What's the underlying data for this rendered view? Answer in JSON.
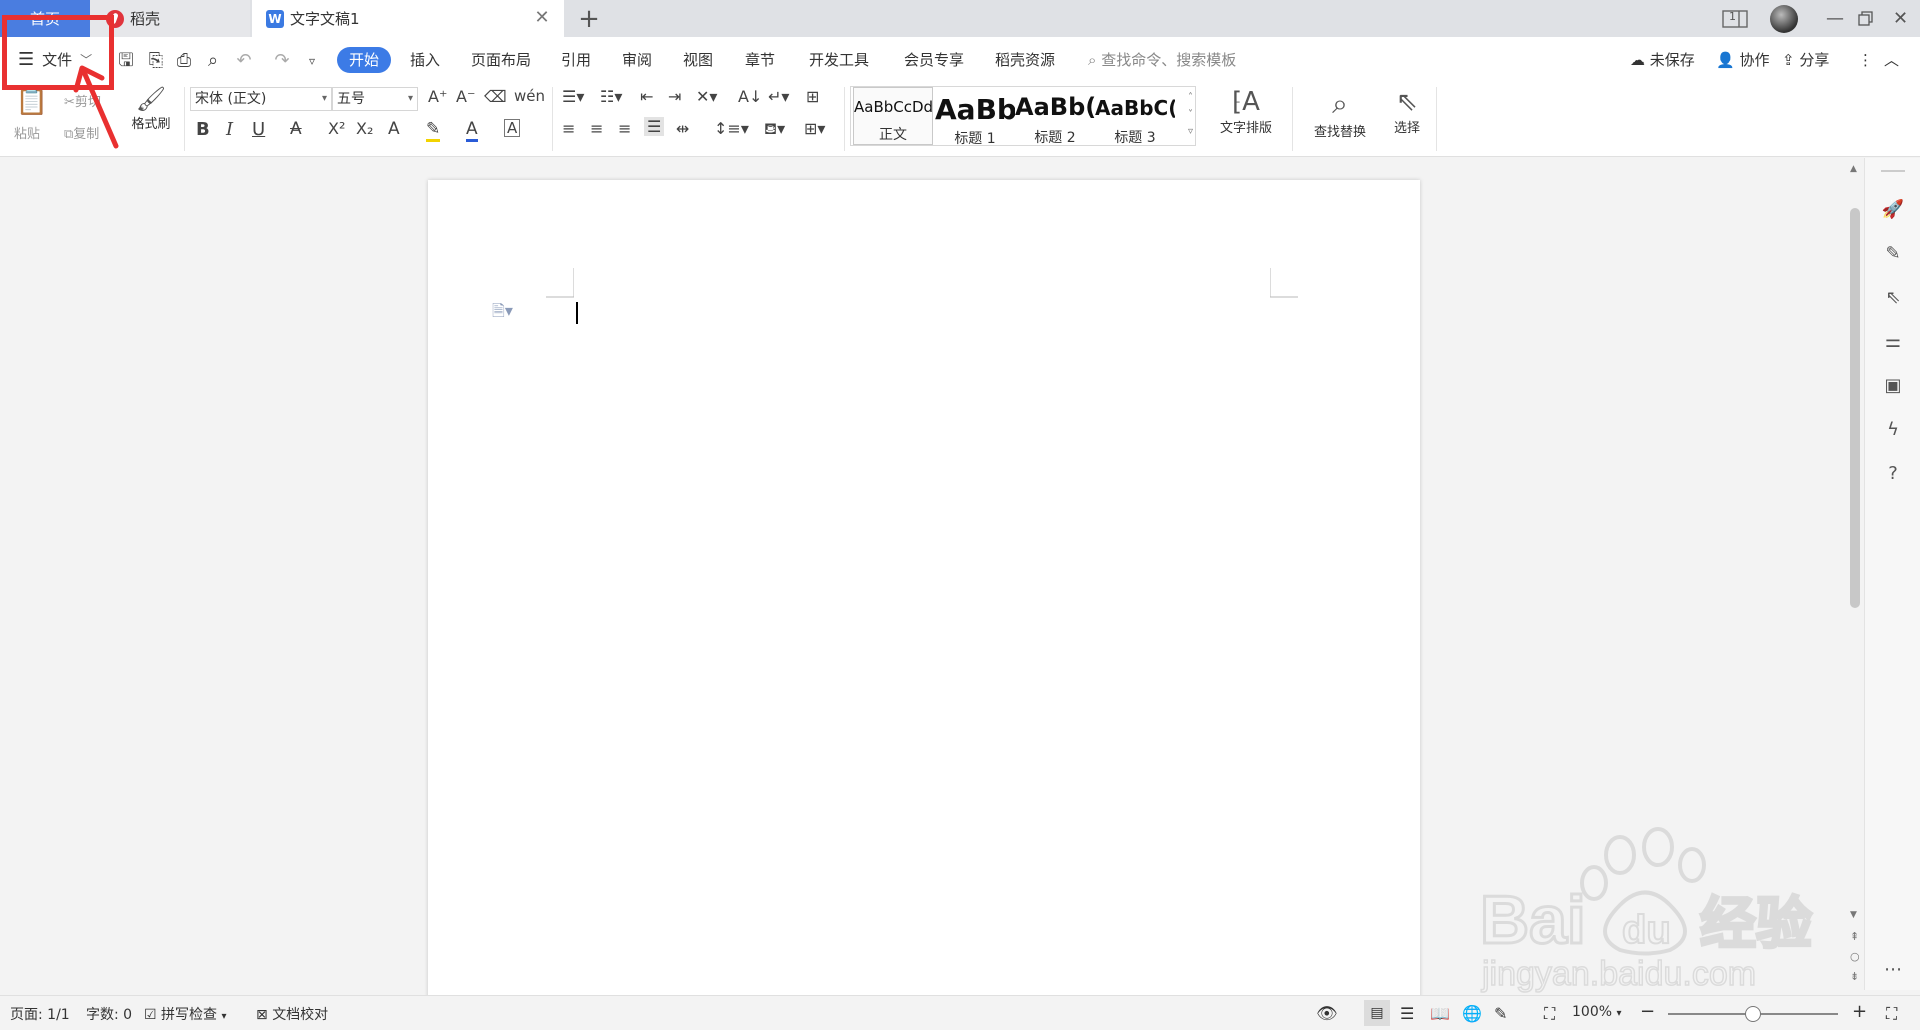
{
  "tabs": {
    "home": "首页",
    "daoke": "稻壳",
    "doc": "文字文稿1",
    "close": "✕",
    "add": "+"
  },
  "window": {
    "page_indicator": "1"
  },
  "menu": {
    "file": "文件",
    "tabs": [
      "开始",
      "插入",
      "页面布局",
      "引用",
      "审阅",
      "视图",
      "章节",
      "开发工具",
      "会员专享",
      "稻壳资源"
    ],
    "search_placeholder": "查找命令、搜索模板",
    "unsaved": "未保存",
    "collab": "协作",
    "share": "分享"
  },
  "ribbon": {
    "paste": "粘贴",
    "cut": "剪切",
    "copy": "复制",
    "format_painter": "格式刷",
    "font_name": "宋体 (正文)",
    "font_size": "五号",
    "styles": [
      {
        "sample": "AaBbCcDd",
        "name": "正文"
      },
      {
        "sample": "AaBb",
        "name": "标题 1"
      },
      {
        "sample": "AaBb(",
        "name": "标题 2"
      },
      {
        "sample": "AaBbC(",
        "name": "标题 3"
      }
    ],
    "text_layout": "文字排版",
    "find_replace": "查找替换",
    "select": "选择"
  },
  "status": {
    "page": "页面: 1/1",
    "words": "字数: 0",
    "spell": "拼写检查",
    "proof": "文档校对",
    "zoom": "100%"
  },
  "watermark": {
    "brand": "Bai",
    "brand2": "du",
    "cn": "经验",
    "url": "jingyan.baidu.com"
  },
  "colors": {
    "accent": "#3c7be6",
    "home_tab": "#4a7de0",
    "highlight": "#e93030"
  }
}
